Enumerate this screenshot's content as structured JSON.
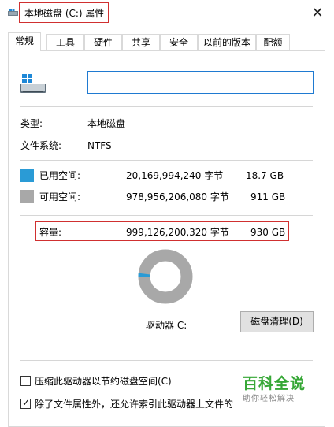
{
  "window": {
    "title": "本地磁盘 (C:) 属性",
    "close_glyph": "✕"
  },
  "tabs": [
    "常规",
    "工具",
    "硬件",
    "共享",
    "安全",
    "以前的版本",
    "配额"
  ],
  "active_tab": "常规",
  "volume_name_value": "",
  "info": {
    "type_label": "类型:",
    "type_value": "本地磁盘",
    "fs_label": "文件系统:",
    "fs_value": "NTFS"
  },
  "space": {
    "used_label": "已用空间:",
    "used_bytes": "20,169,994,240 字节",
    "used_size": "18.7 GB",
    "free_label": "可用空间:",
    "free_bytes": "978,956,206,080 字节",
    "free_size": "911 GB",
    "capacity_label": "容量:",
    "capacity_bytes": "999,126,200,320 字节",
    "capacity_size": "930 GB"
  },
  "chart_data": {
    "type": "pie",
    "categories": [
      "已用空间",
      "可用空间"
    ],
    "values": [
      20169994240,
      978956206080
    ]
  },
  "drive_label": "驱动器 C:",
  "clean_button": "磁盘清理(D)",
  "options": {
    "compress_label": "压缩此驱动器以节约磁盘空间(C)",
    "compress_checked": false,
    "index_label": "除了文件属性外，还允许索引此驱动器上文件的",
    "index_checked": true
  },
  "watermark": {
    "main": "百科全说",
    "sub": "助你轻松解决"
  },
  "colors": {
    "used": "#2a9bd6",
    "free": "#a8a8a8",
    "highlight": "#d03030",
    "input_border": "#1f7ad1",
    "watermark": "#36a736"
  },
  "icons": {
    "title": "drive-icon",
    "close": "close-icon",
    "drive": "drive-icon"
  }
}
